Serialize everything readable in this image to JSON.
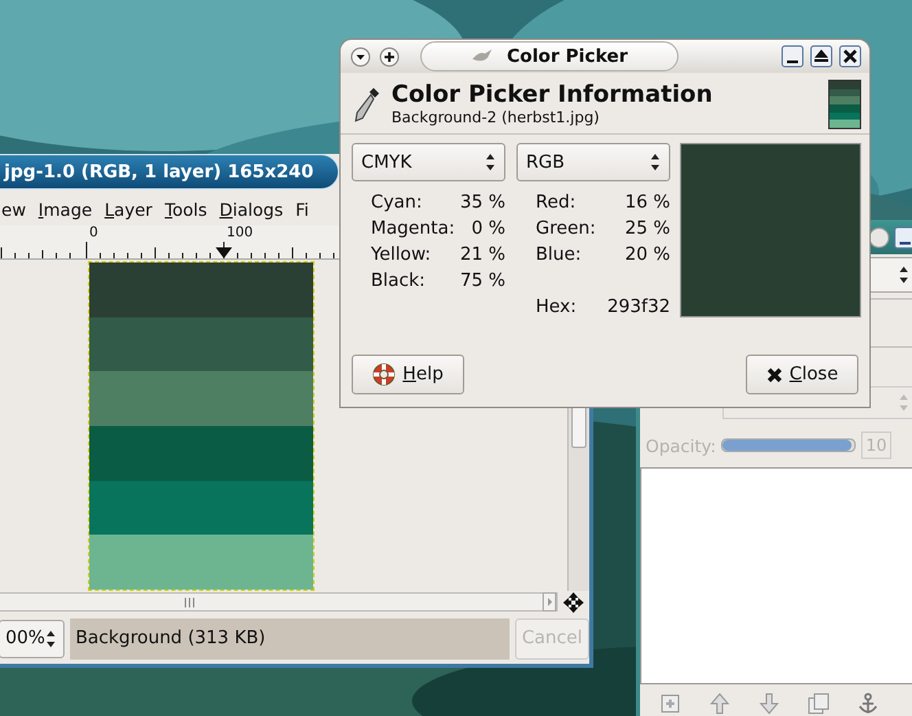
{
  "image_window": {
    "title": "jpg-1.0 (RGB, 1 layer) 165x240",
    "menu": [
      {
        "label": "ew",
        "mnemonic": false
      },
      {
        "label": "Image",
        "mnemonic": true
      },
      {
        "label": "Layer",
        "mnemonic": true
      },
      {
        "label": "Tools",
        "mnemonic": true
      },
      {
        "label": "Dialogs",
        "mnemonic": true
      },
      {
        "label": "Fi",
        "mnemonic": false
      }
    ],
    "ruler_labels": [
      "0",
      "100"
    ],
    "image_stripes": [
      {
        "color": "#2b4034"
      },
      {
        "color": "#335b49"
      },
      {
        "color": "#4f7f63"
      },
      {
        "color": "#0a5d44"
      },
      {
        "color": "#07745b"
      },
      {
        "color": "#6db591"
      }
    ],
    "zoom": "00%",
    "status": "Background (313 KB)",
    "cancel": {
      "label": "Cancel",
      "disabled": true
    }
  },
  "color_picker": {
    "title": "Color Picker",
    "heading": "Color Picker Information",
    "subtitle": "Background-2 (herbst1.jpg)",
    "left": {
      "mode": "CMYK",
      "rows": [
        {
          "label": "Cyan:",
          "value": "35 %"
        },
        {
          "label": "Magenta:",
          "value": "0 %"
        },
        {
          "label": "Yellow:",
          "value": "21 %"
        },
        {
          "label": "Black:",
          "value": "75 %"
        }
      ]
    },
    "right": {
      "mode": "RGB",
      "rows": [
        {
          "label": "Red:",
          "value": "16 %"
        },
        {
          "label": "Green:",
          "value": "25 %"
        },
        {
          "label": "Blue:",
          "value": "20 %"
        }
      ]
    },
    "hex": {
      "label": "Hex:",
      "value": "293f32"
    },
    "swatch": {
      "color": "#293f32"
    },
    "buttons": [
      {
        "label": "Help",
        "kind": "help"
      },
      {
        "label": "Close",
        "kind": "close"
      }
    ]
  },
  "dock": {
    "opacity_label": "Opacity:",
    "opacity_value": "10",
    "disabled": true,
    "level": 0.97
  }
}
